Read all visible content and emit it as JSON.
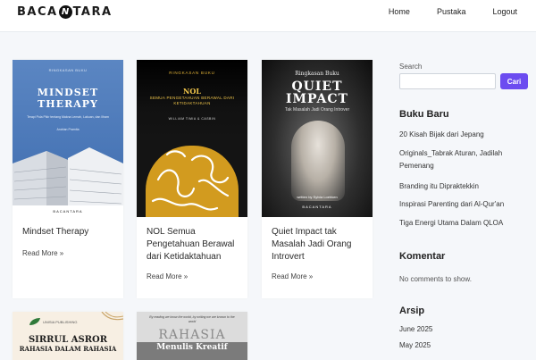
{
  "header": {
    "logo_left": "BACA",
    "logo_badge": "N",
    "logo_right": "TARA",
    "nav": [
      {
        "label": "Home"
      },
      {
        "label": "Pustaka"
      },
      {
        "label": "Logout"
      }
    ]
  },
  "posts": [
    {
      "title": "Mindset Therapy",
      "read_more": "Read More »",
      "cover": {
        "small": "RINGKASAN BUKU",
        "line1": "MINDSET",
        "line2": "THERAPY",
        "subtitle": "Terapi Pola Pikir tentang Makna Lemah, Lakuan, dan Ilham",
        "author": "Andrian Pramita",
        "footer": "BACANTARA"
      }
    },
    {
      "title": "NOL Semua Pengetahuan Berawal dari Ketidaktahuan",
      "read_more": "Read More »",
      "cover": {
        "small": "RINGKASAN BUKU",
        "line1": "NOL",
        "line2": "SEMUA PENGETAHUAN BERAWAL DARI KETIDAKTAHUAN",
        "author": "WILLIAM TIMIA & CASBIN"
      }
    },
    {
      "title": "Quiet Impact tak Masalah Jadi Orang Introvert",
      "read_more": "Read More »",
      "cover": {
        "small": "Ringkasan Buku",
        "line1": "QUIET",
        "line2": "IMPACT",
        "subtitle": "Tak Masalah Jadi Orang Introver",
        "author": "written by Sylvia Loehken",
        "footer": "BACANTARA"
      }
    },
    {
      "cover": {
        "publisher": "UNISIA PUBLISHING",
        "line1": "SIRRUL ASROR",
        "line2": "RAHASIA DALAM RAHASIA"
      }
    },
    {
      "cover": {
        "quote": "By reading we know the world, by writing we are known to the world",
        "line1": "RAHASIA",
        "line2": "Menulis Kreatif"
      }
    }
  ],
  "sidebar": {
    "search_label": "Search",
    "search_value": "",
    "search_button": "Cari",
    "new_books_heading": "Buku Baru",
    "new_books": [
      "20 Kisah Bijak dari Jepang",
      "Originals_Tabrak Aturan, Jadilah Pemenang",
      "Branding itu Dipraktekkin",
      "Inspirasi Parenting dari Al-Qur'an",
      "Tiga Energi Utama Dalam QLOA"
    ],
    "comments_heading": "Komentar",
    "comments_empty": "No comments to show.",
    "archive_heading": "Arsip",
    "archives": [
      "June 2025",
      "May 2025"
    ]
  },
  "colors": {
    "accent": "#6c4cf0",
    "page_bg": "#f5f7fa"
  }
}
